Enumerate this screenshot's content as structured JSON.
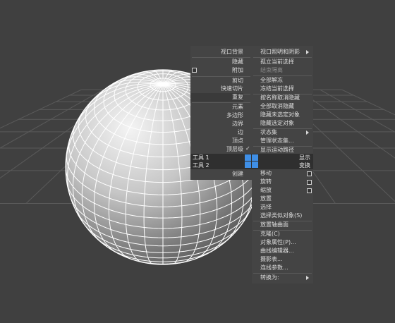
{
  "left_menu": {
    "items": [
      {
        "label": "视口背景"
      },
      {
        "label": "隐藏"
      },
      {
        "label": "附加"
      },
      {
        "label": "剪切"
      },
      {
        "label": "快速切片"
      },
      {
        "label": "重复"
      },
      {
        "label": "元素"
      },
      {
        "label": "多边形"
      },
      {
        "label": "边界"
      },
      {
        "label": "边"
      },
      {
        "label": "顶点"
      },
      {
        "label": "顶层级"
      },
      {
        "label": "创建"
      }
    ],
    "quad_tool1": {
      "name": "工具 1",
      "right": "显示"
    },
    "quad_tool2": {
      "name": "工具 2",
      "right": "变换"
    }
  },
  "right_menu": {
    "items": [
      {
        "label": "视口照明和阴影"
      },
      {
        "label": "孤立当前选择"
      },
      {
        "label": "结束隔离"
      },
      {
        "label": "全部解冻"
      },
      {
        "label": "冻结当前选择"
      },
      {
        "label": "按名称取消隐藏"
      },
      {
        "label": "全部取消隐藏"
      },
      {
        "label": "隐藏未选定对象"
      },
      {
        "label": "隐藏选定对象"
      },
      {
        "label": "状态集"
      },
      {
        "label": "管理状态集..."
      },
      {
        "label": "显示运动路径"
      },
      {
        "label": "移动"
      },
      {
        "label": "旋转"
      },
      {
        "label": "缩放"
      },
      {
        "label": "放置"
      },
      {
        "label": "选择"
      },
      {
        "label": "选择类似对象(S)"
      },
      {
        "label": "放置轴曲面"
      },
      {
        "label": "克隆(C)"
      },
      {
        "label": "对象属性(P)..."
      },
      {
        "label": "曲线编辑器..."
      },
      {
        "label": "摄影表..."
      },
      {
        "label": "连线参数..."
      },
      {
        "label": "转换为:"
      }
    ]
  },
  "colors": {
    "background": "#404040",
    "menu_bg": "#444444",
    "quad_bar": "#2f2f2f",
    "accent_blue": "#3f8fe6",
    "grid": "#5a5a5a",
    "wire": "#ffffff"
  },
  "icons": [
    "submenu-arrow-icon",
    "checkbox-icon",
    "checkmark-icon",
    "quad-selector-icon"
  ]
}
